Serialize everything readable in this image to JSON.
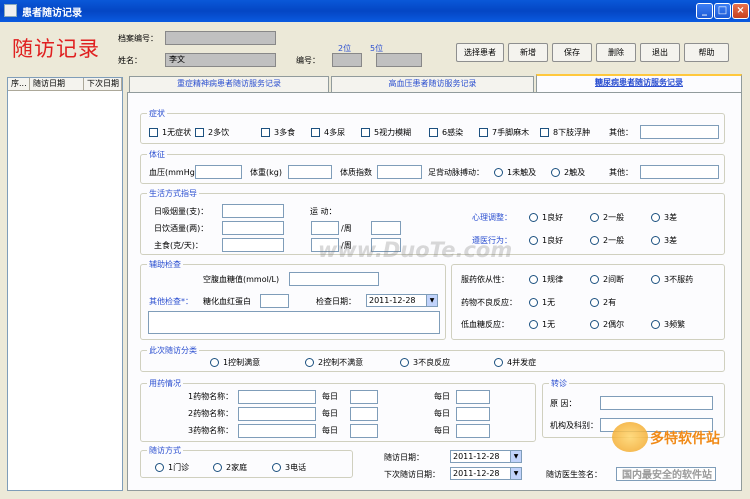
{
  "window": {
    "title": "患者随访记录"
  },
  "header": {
    "big_title": "随访记录",
    "archive_label": "档案编号：",
    "name_label": "姓名：",
    "name_value": "李文",
    "number_label": "编号：",
    "digits2": "2位",
    "digits5": "5位"
  },
  "toolbar": {
    "select": "选择患者",
    "new": "新增",
    "save": "保存",
    "delete": "删除",
    "exit": "退出",
    "help": "帮助"
  },
  "list": {
    "columns": [
      "序...",
      "随访日期",
      "下次日期"
    ]
  },
  "tabs": [
    "重症精神病患者随访服务记录",
    "高血压患者随访服务记录",
    "糖尿病患者随访服务记录"
  ],
  "symptoms": {
    "title": "症状",
    "items": [
      "1无症状",
      "2多饮",
      "3多食",
      "4多尿",
      "5视力模糊",
      "6感染",
      "7手脚麻木",
      "8下肢浮肿"
    ],
    "other": "其他："
  },
  "signs": {
    "title": "体征",
    "bp": "血压(mmHg)",
    "weight": "体重(kg)",
    "bmi": "体质指数",
    "pulse": "足背动脉搏动：",
    "opt1": "1未触及",
    "opt2": "2触及",
    "other": "其他："
  },
  "lifestyle": {
    "title": "生活方式指导",
    "smoke": "日吸烟量(支)：",
    "drink": "日饮酒量(两)：",
    "food": "主食(克/天)：",
    "exercise": "运 动：",
    "per_week": "/周",
    "mental": "心理调整：",
    "compliance": "遵医行为：",
    "good": "1良好",
    "fair": "2一般",
    "poor": "3差"
  },
  "aux": {
    "title": "辅助检查",
    "fbg": "空腹血糖值(mmol/L)",
    "other_check": "其他检查*：",
    "hba1c": "糖化血红蛋白",
    "check_date": "检查日期：",
    "date": "2011-12-28"
  },
  "meds": {
    "adherence": "服药依从性：",
    "a1": "1规律",
    "a2": "2间断",
    "a3": "3不服药",
    "adverse": "药物不良反应：",
    "b1": "1无",
    "b2": "2有",
    "hypo": "低血糖反应：",
    "c1": "1无",
    "c2": "2偶尔",
    "c3": "3频繁"
  },
  "classification": {
    "title": "此次随访分类",
    "items": [
      "1控制满意",
      "2控制不满意",
      "3不良反应",
      "4并发症"
    ]
  },
  "medication": {
    "title": "用药情况",
    "drugs": [
      "1药物名称：",
      "2药物名称：",
      "3药物名称："
    ],
    "daily": "每日"
  },
  "referral": {
    "title": "转诊",
    "reason": "原 因：",
    "dept": "机构及科别："
  },
  "visit": {
    "title": "随访方式",
    "items": [
      "1门诊",
      "2家庭",
      "3电话"
    ],
    "visit_date": "随访日期：",
    "next_date": "下次随访日期：",
    "date1": "2011-12-28",
    "date2": "2011-12-28",
    "doctor": "随访医生签名："
  },
  "watermark": {
    "site": "www.DuoTe.com",
    "brand1": "多特软件站",
    "brand2": "国内最安全的软件站"
  }
}
